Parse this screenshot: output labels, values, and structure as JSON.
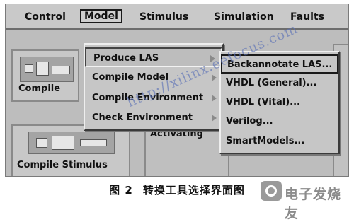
{
  "menubar": {
    "items": [
      {
        "label": "Control"
      },
      {
        "label": "Model"
      },
      {
        "label": "Stimulus"
      },
      {
        "label": "Simulation"
      },
      {
        "label": "Faults"
      }
    ]
  },
  "panels": {
    "compile_model_label": "Compile",
    "compile_stimulus_label": "Compile Stimulus",
    "activating_text": "Activating"
  },
  "model_menu": {
    "items": [
      {
        "label": "Produce LAS",
        "has_submenu": true
      },
      {
        "label": "Compile Model",
        "has_submenu": true
      },
      {
        "label": "Compile Environment",
        "has_submenu": true
      },
      {
        "label": "Check Environment",
        "has_submenu": true
      }
    ]
  },
  "submenu": {
    "items": [
      {
        "label": "Backannotate LAS..."
      },
      {
        "label": "VHDL (General)..."
      },
      {
        "label": "VHDL (Vital)..."
      },
      {
        "label": "Verilog..."
      },
      {
        "label": "SmartModels..."
      }
    ]
  },
  "watermark": "http://xilinx.eefocus.com",
  "logo_text": "电子发烧友",
  "caption": {
    "number": "图 2",
    "title": "转换工具选择界面图"
  }
}
